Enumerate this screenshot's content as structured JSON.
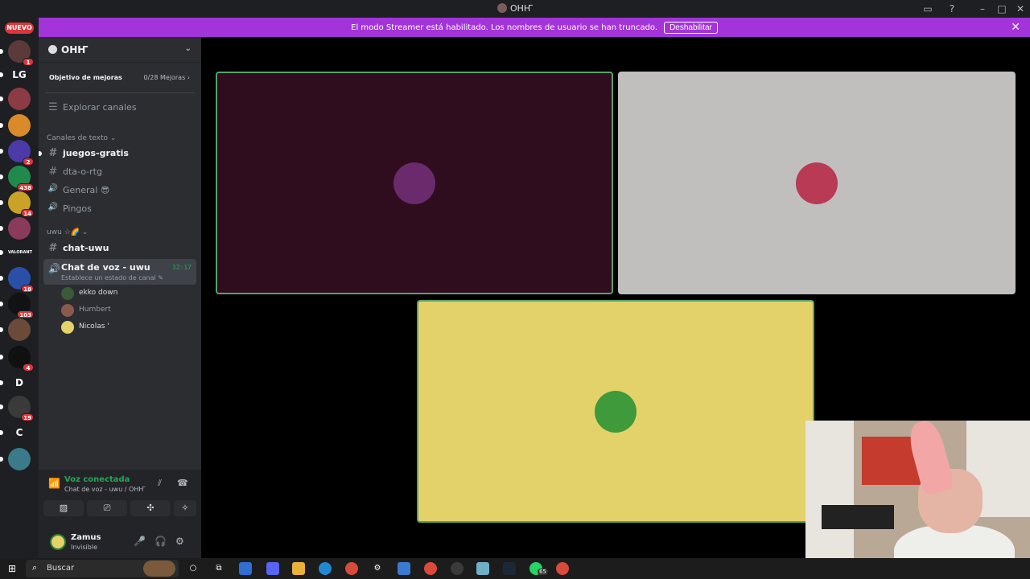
{
  "window": {
    "title": "OHҤ"
  },
  "banner": {
    "message": "El modo Streamer está habilitado. Los nombres de usuario se han truncado.",
    "disable_label": "Deshabilitar"
  },
  "guilds": {
    "new_label": "NUEVO",
    "items": [
      {
        "initials": "",
        "badge": "1",
        "color": "#5b3a3a"
      },
      {
        "initials": "LG",
        "badge": "",
        "color": "#1e1f22"
      },
      {
        "initials": "",
        "badge": "",
        "color": "#8c3a44"
      },
      {
        "initials": "",
        "badge": "",
        "color": "#d98a2b"
      },
      {
        "initials": "",
        "badge": "2",
        "color": "#4b3aa8"
      },
      {
        "initials": "",
        "badge": "438",
        "color": "#1f8a4c"
      },
      {
        "initials": "",
        "badge": "14",
        "color": "#c9a227"
      },
      {
        "initials": "",
        "badge": "",
        "color": "#8a3a5a"
      },
      {
        "initials": "VALORANT",
        "badge": "",
        "color": "#1e1f22"
      },
      {
        "initials": "",
        "badge": "18",
        "color": "#2a4fa8"
      },
      {
        "initials": "",
        "badge": "103",
        "color": "#111214"
      },
      {
        "initials": "",
        "badge": "",
        "color": "#6b4a3a"
      },
      {
        "initials": "",
        "badge": "4",
        "color": "#101010"
      },
      {
        "initials": "D",
        "badge": "",
        "color": "#1e1f22"
      },
      {
        "initials": "",
        "badge": "19",
        "color": "#3a3a3a"
      },
      {
        "initials": "C",
        "badge": "",
        "color": "#1e1f22"
      },
      {
        "initials": "",
        "badge": "",
        "color": "#3a7a8a"
      }
    ]
  },
  "server": {
    "name": "OHҤ",
    "boost_label": "Objetivo de mejoras",
    "boost_count": "0/28 Mejoras",
    "browse_channels": "Explorar canales",
    "category_text": "Canales de texto",
    "channels_top": [
      {
        "name": "juegos-gratis",
        "type": "text",
        "unread": true
      },
      {
        "name": "dta-o-rtg",
        "type": "text",
        "unread": false
      },
      {
        "name": "General 😎",
        "type": "voice",
        "unread": false
      },
      {
        "name": "Pingos",
        "type": "voice",
        "unread": false
      }
    ],
    "category_uwu": "uwu",
    "channel_chat": "chat-uwu",
    "voice_channel": {
      "name": "Chat de voz - uwu",
      "status": "Establece un estado de canal",
      "elapsed": "32:17",
      "users": [
        {
          "name": "ekko down",
          "muted": false,
          "color": "#3a5a3a"
        },
        {
          "name": "Humbert",
          "muted": true,
          "color": "#8a5a4a"
        },
        {
          "name": "Nicolas '",
          "muted": false,
          "color": "#e3d26a"
        }
      ]
    }
  },
  "voice_panel": {
    "title": "Voz conectada",
    "subtitle": "Chat de voz - uwu / OHҤ"
  },
  "user": {
    "name": "Zamus",
    "status": "Invisible"
  },
  "tiles": [
    {
      "label": "tile-purple",
      "bg": "#2f0d1f",
      "speaking": true,
      "avatar_color": "#6b2a6b"
    },
    {
      "label": "tile-grey",
      "bg": "#c1bfbd",
      "speaking": false,
      "avatar_color": "#b83a55"
    },
    {
      "label": "tile-yellow",
      "bg": "#e3d26a",
      "speaking": true,
      "avatar_color": "#3e9a3a"
    }
  ],
  "taskbar": {
    "search_placeholder": "Buscar",
    "whatsapp_badge": "65"
  }
}
